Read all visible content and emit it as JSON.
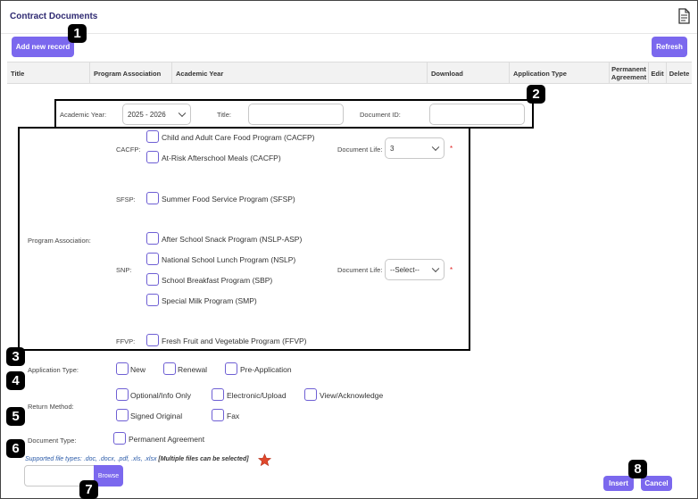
{
  "header": {
    "title": "Contract Documents",
    "doc_icon": "document-icon"
  },
  "toolbar": {
    "add_label": "Add new record",
    "refresh_label": "Refresh"
  },
  "table": {
    "columns": [
      "Title",
      "Program Association",
      "Academic Year",
      "Download",
      "Application Type",
      "Permanent Agreement",
      "Edit",
      "Delete"
    ]
  },
  "badges": [
    "1",
    "2",
    "3",
    "4",
    "5",
    "6",
    "7",
    "8"
  ],
  "form": {
    "academic_year_label": "Academic Year:",
    "academic_year_value": "2025 - 2026",
    "title_label": "Title:",
    "document_id_label": "Document ID:",
    "program_association_label": "Program Association:",
    "cacfp": {
      "label": "CACFP:",
      "options": [
        "Child and Adult Care Food Program (CACFP)",
        "At-Risk Afterschool Meals (CACFP)"
      ],
      "document_life_label": "Document Life:",
      "document_life_value": "3"
    },
    "sfsp": {
      "label": "SFSP:",
      "options": [
        "Summer Food Service Program (SFSP)"
      ]
    },
    "snp": {
      "label": "SNP:",
      "options": [
        "After School Snack Program (NSLP-ASP)",
        "National School Lunch Program (NSLP)",
        "School Breakfast Program (SBP)",
        "Special Milk Program (SMP)"
      ],
      "document_life_label": "Document Life:",
      "document_life_value": "--Select--"
    },
    "ffvp": {
      "label": "FFVP:",
      "options": [
        "Fresh Fruit and Vegetable Program (FFVP)"
      ]
    },
    "required_mark": "*",
    "application_type_label": "Application Type:",
    "application_type_options": [
      "New",
      "Renewal",
      "Pre-Application"
    ],
    "return_method_label": "Return Method:",
    "return_method_options": [
      "Optional/Info Only",
      "Electronic/Upload",
      "View/Acknowledge",
      "Signed Original",
      "Fax"
    ],
    "document_type_label": "Document Type:",
    "document_type_options": [
      "Permanent Agreement"
    ],
    "supported_types": "Supported file types: .doc, .docx, .pdf, .xls, .xlsx",
    "multiple_note": "[Multiple files can be selected]",
    "browse_label": "Browse"
  },
  "actions": {
    "insert_label": "Insert",
    "cancel_label": "Cancel"
  },
  "colors": {
    "accent": "#7b68ee",
    "title": "#2f2a72",
    "required": "#e02020",
    "badge": "#000000"
  }
}
